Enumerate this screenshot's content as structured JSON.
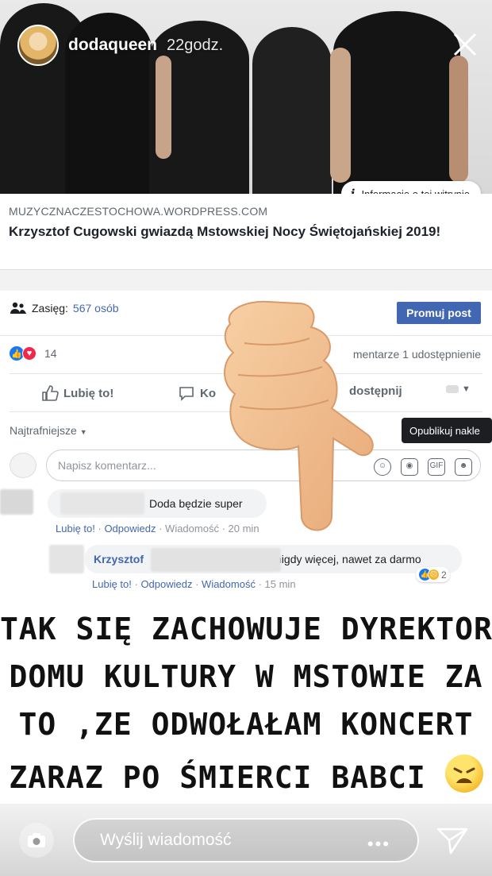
{
  "story": {
    "username": "dodaqueen",
    "time_ago": "22godz.",
    "progress_segments": 10,
    "progress_done": 4
  },
  "link_card": {
    "info_label": "Informacje o tej witrynie",
    "domain": "MUZYCZNACZESTOCHOWA.WORDPRESS.COM",
    "title": "Krzysztof Cugowski gwiazdą Mstowskiej Nocy Świętojańskiej 2019!"
  },
  "post": {
    "reach_label": "Zasięg:",
    "reach_count": "567 osób",
    "promote_label": "Promuj post",
    "reaction_count": "14",
    "stats": "mentarze  1 udostępnienie",
    "actions": {
      "like": "Lubię to!",
      "comment": "Ko",
      "share": "dostępnij"
    },
    "sort_label": "Najtrafniejsze",
    "tooltip": "Opublikuj nakle",
    "comment_placeholder": "Napisz komentarz..."
  },
  "comments": [
    {
      "text": "Doda będzie super",
      "like": "Lubię to!",
      "reply": "Odpowiedz",
      "message": "Wiadomość",
      "time": "20 min"
    },
    {
      "author": "Krzysztof",
      "text": "nigdy więcej, nawet za darmo",
      "like": "Lubię to!",
      "reply": "Odpowiedz",
      "message": "Wiadomość",
      "time": "15 min",
      "reactions": "2"
    }
  ],
  "caption": {
    "line1": "TAK SIĘ ZACHOWUJE DYREKTOR",
    "line2": "DOMU KULTURY W MSTOWIE ZA",
    "line3": "TO ,ZE ODWOŁAŁAM KONCERT",
    "line4": "ZARAZ PO ŚMIERCI BABCI"
  },
  "reply_bar": {
    "placeholder": "Wyślij wiadomość",
    "more": "•••"
  },
  "colors": {
    "facebook_blue": "#4267b2",
    "like_blue": "#1877f2",
    "love_red": "#f0284a"
  }
}
